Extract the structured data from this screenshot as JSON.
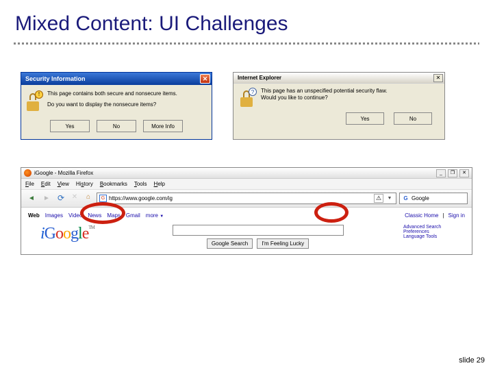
{
  "title": "Mixed Content: UI Challenges",
  "footer": "slide 29",
  "dialog1": {
    "title": "Security Information",
    "line1": "This page contains both secure and nonsecure items.",
    "line2": "Do you want to display the nonsecure items?",
    "yes": "Yes",
    "no": "No",
    "more": "More Info"
  },
  "dialog2": {
    "title": "Internet Explorer",
    "line1": "This page has an unspecified potential security flaw.",
    "line2": "Would you like to continue?",
    "yes": "Yes",
    "no": "No"
  },
  "firefox": {
    "windowTitle": "iGoogle - Mozilla Firefox",
    "menu": {
      "file": "File",
      "edit": "Edit",
      "view": "View",
      "history": "History",
      "bookmarks": "Bookmarks",
      "tools": "Tools",
      "help": "Help"
    },
    "url": "https://www.google.com/ig",
    "searchEngine": "Google",
    "tabs": {
      "web": "Web",
      "images": "Images",
      "video": "Video",
      "news": "News",
      "maps": "Maps",
      "gmail": "Gmail",
      "more": "more"
    },
    "right": {
      "classic": "Classic Home",
      "signin": "Sign in"
    },
    "logo_i": "i",
    "logo_g1": "G",
    "logo_o1": "o",
    "logo_o2": "o",
    "logo_g2": "g",
    "logo_l": "l",
    "logo_e": "e",
    "tm": "TM",
    "btn1": "Google Search",
    "btn2": "I'm Feeling Lucky",
    "link1": "Advanced Search",
    "link2": "Preferences",
    "link3": "Language Tools"
  }
}
